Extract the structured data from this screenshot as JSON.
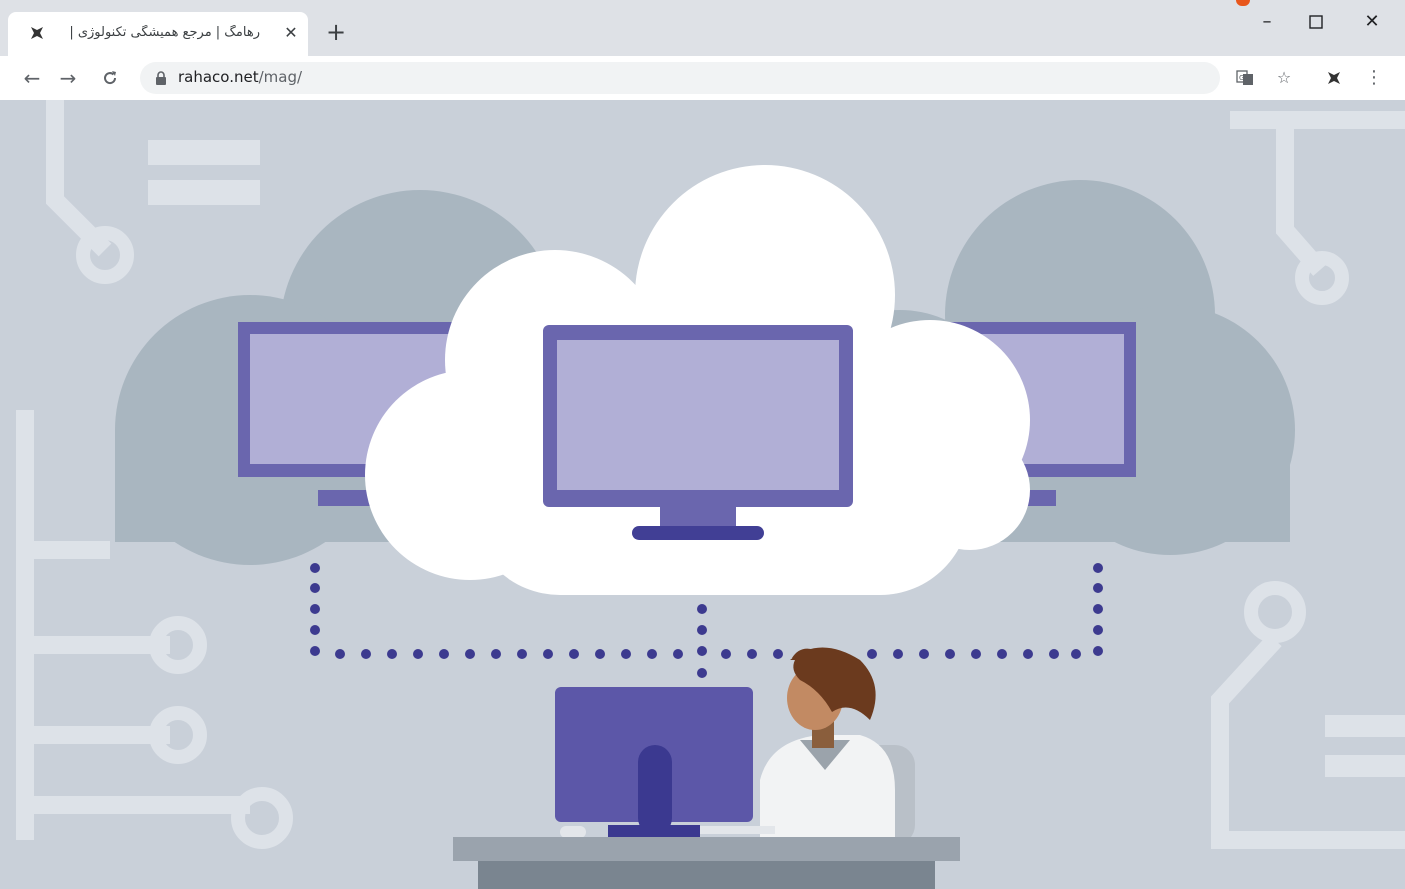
{
  "browser": {
    "tab": {
      "title": "رهامگ | مرجع همیشگی تکنولوژی |",
      "close_glyph": "✕"
    },
    "new_tab_glyph": "+",
    "window_controls": {
      "minimize": "–",
      "maximize": "☐",
      "close": "✕"
    },
    "nav": {
      "back": "←",
      "forward": "→",
      "reload": "C"
    },
    "url": {
      "host": "rahaco.net",
      "path": "/mag/"
    },
    "toolbar_icons": {
      "translate": "translate-icon",
      "bookmark": "☆",
      "extension": "rahaco-extension-icon",
      "menu": "⋮"
    }
  },
  "colors": {
    "page_bg": "#c9d0d9",
    "cloud_back": "#a9b6c0",
    "cloud_front": "#ffffff",
    "monitor_frame": "#6a66ae",
    "monitor_screen": "#b1afd6",
    "monitor_dark": "#413f95",
    "dots": "#3c3a8f",
    "circuit": "#dde2e8"
  }
}
